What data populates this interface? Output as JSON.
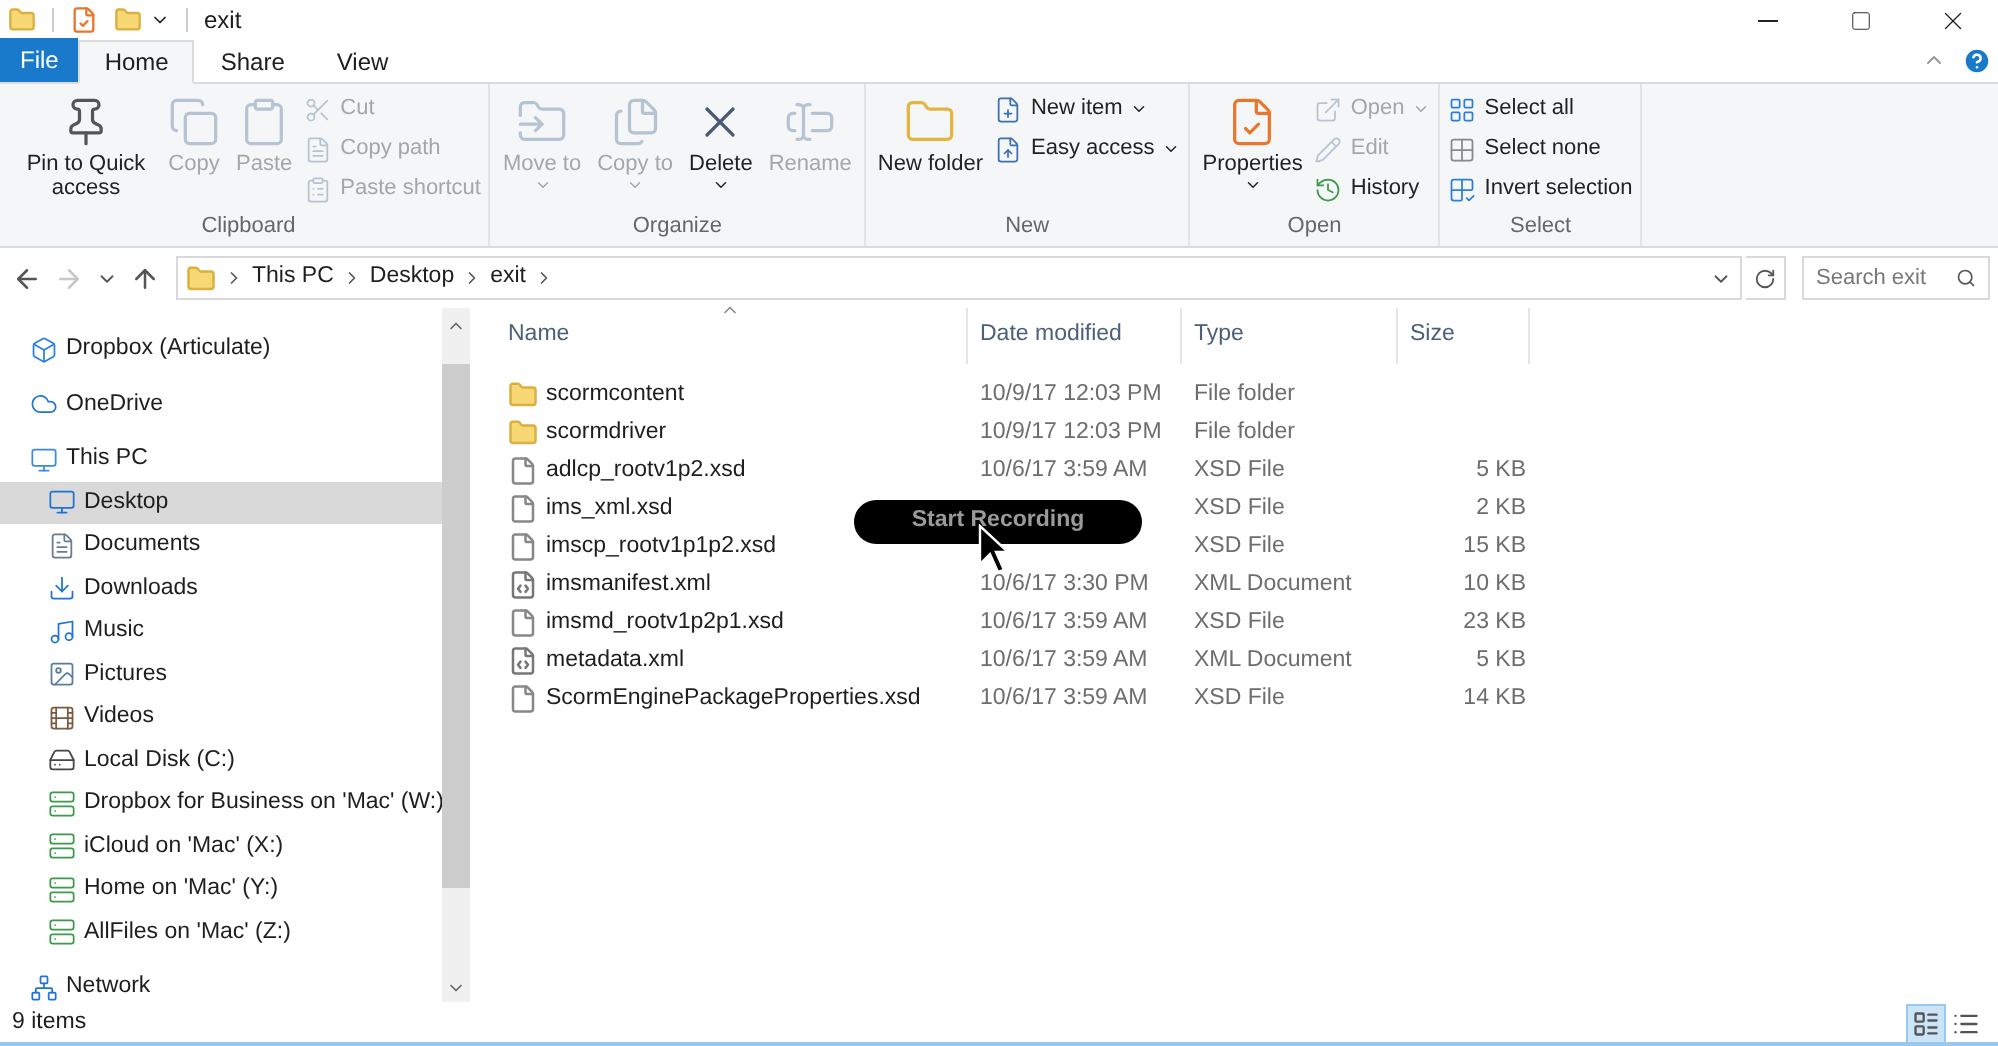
{
  "window": {
    "title": "exit"
  },
  "ribbon_tabs": [
    {
      "label": "File",
      "kind": "file",
      "selected": false
    },
    {
      "label": "Home",
      "kind": "tab",
      "selected": true
    },
    {
      "label": "Share",
      "kind": "tab",
      "selected": false
    },
    {
      "label": "View",
      "kind": "tab",
      "selected": false
    }
  ],
  "ribbon_groups": [
    {
      "label": "Clipboard",
      "items": [
        {
          "kind": "large",
          "label": "Pin to Quick access",
          "disabled": false,
          "dropdown": false
        },
        {
          "kind": "large",
          "label": "Copy",
          "disabled": true,
          "dropdown": false
        },
        {
          "kind": "large",
          "label": "Paste",
          "disabled": true,
          "dropdown": false
        },
        {
          "kind": "stack",
          "items": [
            {
              "label": "Cut",
              "disabled": true,
              "dropdown": false
            },
            {
              "label": "Copy path",
              "disabled": true,
              "dropdown": false
            },
            {
              "label": "Paste shortcut",
              "disabled": true,
              "dropdown": false
            }
          ]
        }
      ]
    },
    {
      "label": "Organize",
      "items": [
        {
          "kind": "large",
          "label": "Move to",
          "disabled": true,
          "dropdown": true
        },
        {
          "kind": "large",
          "label": "Copy to",
          "disabled": true,
          "dropdown": true
        },
        {
          "kind": "large",
          "label": "Delete",
          "disabled": false,
          "dropdown": true
        },
        {
          "kind": "large",
          "label": "Rename",
          "disabled": true,
          "dropdown": false
        }
      ]
    },
    {
      "label": "New",
      "items": [
        {
          "kind": "large",
          "label": "New folder",
          "disabled": false,
          "dropdown": false
        },
        {
          "kind": "stack",
          "items": [
            {
              "label": "New item",
              "disabled": false,
              "dropdown": true
            },
            {
              "label": "Easy access",
              "disabled": false,
              "dropdown": true
            }
          ]
        }
      ]
    },
    {
      "label": "Open",
      "items": [
        {
          "kind": "large",
          "label": "Properties",
          "disabled": false,
          "dropdown": true
        },
        {
          "kind": "stack",
          "items": [
            {
              "label": "Open",
              "disabled": true,
              "dropdown": true
            },
            {
              "label": "Edit",
              "disabled": true,
              "dropdown": false
            },
            {
              "label": "History",
              "disabled": false,
              "dropdown": false
            }
          ]
        }
      ]
    },
    {
      "label": "Select",
      "items": [
        {
          "kind": "stack",
          "items": [
            {
              "label": "Select all",
              "disabled": false,
              "dropdown": false
            },
            {
              "label": "Select none",
              "disabled": false,
              "dropdown": false
            },
            {
              "label": "Invert selection",
              "disabled": false,
              "dropdown": false
            }
          ]
        }
      ]
    }
  ],
  "nav_buttons": [
    {
      "kind": "back",
      "disabled": false
    },
    {
      "kind": "forward",
      "disabled": true
    },
    {
      "kind": "recent",
      "disabled": false
    },
    {
      "kind": "up",
      "disabled": false
    }
  ],
  "address_bar": {
    "crumbs": [
      "This PC",
      "Desktop",
      "exit"
    ]
  },
  "search": {
    "placeholder": "Search exit"
  },
  "nav_pane": [
    {
      "label": "Dropbox (Articulate)",
      "kind": "dropbox",
      "selected": false
    },
    {
      "label": "OneDrive",
      "kind": "cloud",
      "selected": false
    },
    {
      "label": "This PC",
      "kind": "pc",
      "selected": false,
      "children": [
        {
          "label": "Desktop",
          "kind": "desktop",
          "selected": true
        },
        {
          "label": "Documents",
          "kind": "documents",
          "selected": false
        },
        {
          "label": "Downloads",
          "kind": "downloads",
          "selected": false
        },
        {
          "label": "Music",
          "kind": "music",
          "selected": false
        },
        {
          "label": "Pictures",
          "kind": "pictures",
          "selected": false
        },
        {
          "label": "Videos",
          "kind": "videos",
          "selected": false
        },
        {
          "label": "Local Disk (C:)",
          "kind": "disk",
          "selected": false
        },
        {
          "label": "Dropbox for Business on 'Mac' (W:)",
          "kind": "netdrive",
          "selected": false
        },
        {
          "label": "iCloud on 'Mac' (X:)",
          "kind": "netdrive",
          "selected": false
        },
        {
          "label": "Home on 'Mac' (Y:)",
          "kind": "netdrive",
          "selected": false
        },
        {
          "label": "AllFiles on 'Mac' (Z:)",
          "kind": "netdrive",
          "selected": false
        }
      ]
    },
    {
      "label": "Network",
      "kind": "network",
      "selected": false
    }
  ],
  "file_list": {
    "columns": [
      "Name",
      "Date modified",
      "Type",
      "Size"
    ],
    "rows": [
      {
        "kind": "folder",
        "name": "scormcontent",
        "date": "10/9/17 12:03 PM",
        "type": "File folder"
      },
      {
        "kind": "folder",
        "name": "scormdriver",
        "date": "10/9/17 12:03 PM",
        "type": "File folder"
      },
      {
        "kind": "file",
        "name": "adlcp_rootv1p2.xsd",
        "date": "10/6/17 3:59 AM",
        "type": "XSD File",
        "size": "5 KB"
      },
      {
        "kind": "file",
        "name": "ims_xml.xsd",
        "type": "XSD File",
        "size": "2 KB"
      },
      {
        "kind": "file",
        "name": "imscp_rootv1p1p2.xsd",
        "type": "XSD File",
        "size": "15 KB"
      },
      {
        "kind": "xml",
        "name": "imsmanifest.xml",
        "date": "10/6/17 3:30 PM",
        "type": "XML Document",
        "size": "10 KB"
      },
      {
        "kind": "file",
        "name": "imsmd_rootv1p2p1.xsd",
        "date": "10/6/17 3:59 AM",
        "type": "XSD File",
        "size": "23 KB"
      },
      {
        "kind": "xml",
        "name": "metadata.xml",
        "date": "10/6/17 3:59 AM",
        "type": "XML Document",
        "size": "5 KB"
      },
      {
        "kind": "file",
        "name": "ScormEnginePackageProperties.xsd",
        "date": "10/6/17 3:59 AM",
        "type": "XSD File",
        "size": "14 KB"
      }
    ]
  },
  "recording_pill": {
    "label": "Start Recording"
  },
  "status_bar": {
    "text": "9 items"
  },
  "view_toggles": [
    {
      "kind": "details",
      "selected": true
    },
    {
      "kind": "large_icons",
      "selected": false
    }
  ]
}
